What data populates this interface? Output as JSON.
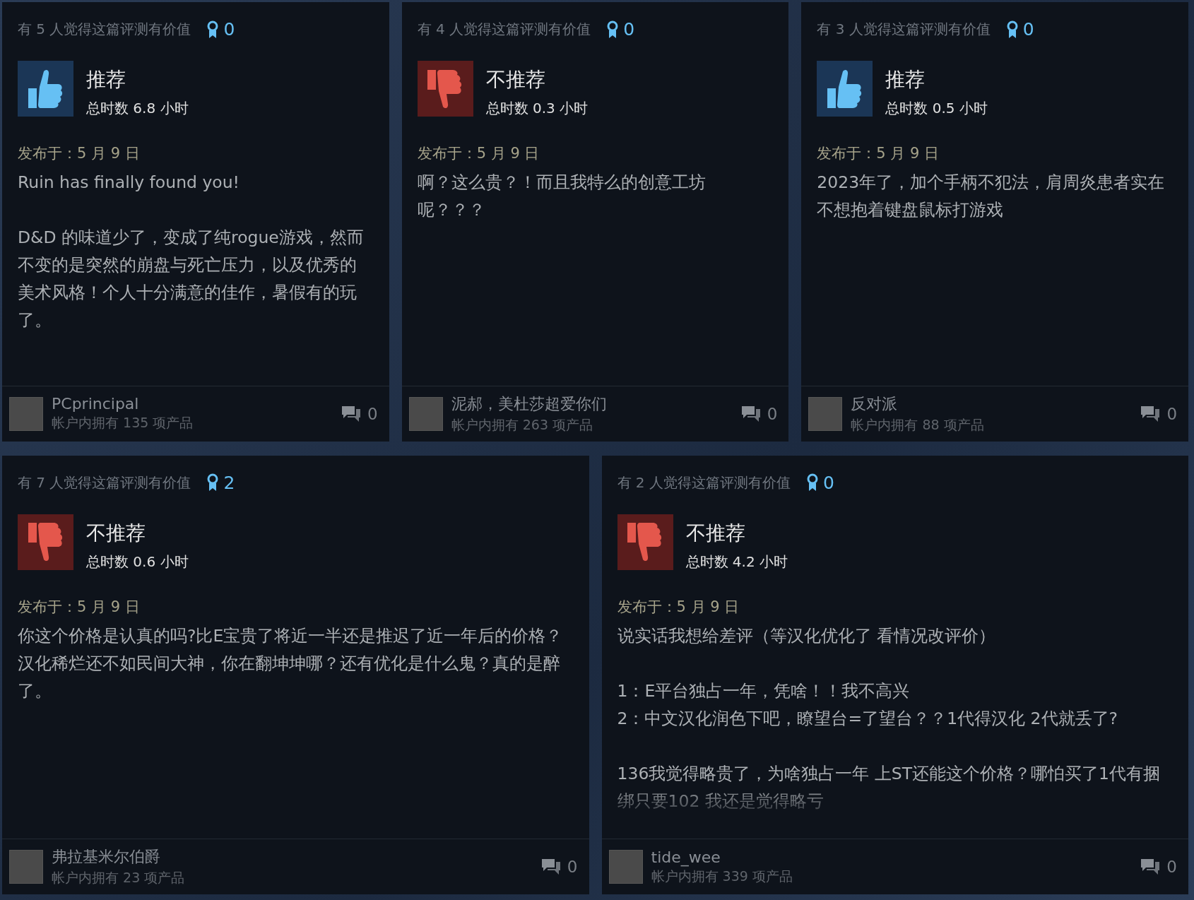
{
  "rows": [
    [
      {
        "helpful": "有 5 人觉得这篇评测有价值",
        "awards": "0",
        "recommended": true,
        "verdict": "推荐",
        "hours": "总时数 6.8 小时",
        "posted": "发布于：5 月 9 日",
        "paragraphs": [
          "Ruin has finally found you!",
          "D&D 的味道少了，变成了纯rogue游戏，然而不变的是突然的崩盘与死亡压力，以及优秀的美术风格！个人十分满意的佳作，暑假有的玩了。"
        ],
        "author": "PCprincipal",
        "products": "帐户内拥有 135 项产品",
        "comments": "0"
      },
      {
        "helpful": "有 4 人觉得这篇评测有价值",
        "awards": "0",
        "recommended": false,
        "verdict": "不推荐",
        "hours": "总时数 0.3 小时",
        "posted": "发布于：5 月 9 日",
        "paragraphs": [
          "啊？这么贵？！而且我特么的创意工坊呢？？？"
        ],
        "author": "泥郝，美杜莎超爱你们",
        "products": "帐户内拥有 263 项产品",
        "comments": "0"
      },
      {
        "helpful": "有 3 人觉得这篇评测有价值",
        "awards": "0",
        "recommended": true,
        "verdict": "推荐",
        "hours": "总时数 0.5 小时",
        "posted": "发布于：5 月 9 日",
        "paragraphs": [
          "2023年了，加个手柄不犯法，肩周炎患者实在不想抱着键盘鼠标打游戏"
        ],
        "author": "反对派",
        "products": "帐户内拥有 88 项产品",
        "comments": "0"
      }
    ],
    [
      {
        "helpful": "有 7 人觉得这篇评测有价值",
        "awards": "2",
        "recommended": false,
        "verdict": "不推荐",
        "hours": "总时数 0.6 小时",
        "posted": "发布于：5 月 9 日",
        "paragraphs": [
          "你这个价格是认真的吗?比E宝贵了将近一半还是推迟了近一年后的价格？汉化稀烂还不如民间大神，你在翻坤坤哪？还有优化是什么鬼？真的是醉了。"
        ],
        "author": "弗拉基米尔伯爵",
        "products": "帐户内拥有 23 项产品",
        "comments": "0"
      },
      {
        "helpful": "有 2 人觉得这篇评测有价值",
        "awards": "0",
        "recommended": false,
        "verdict": "不推荐",
        "hours": "总时数 4.2 小时",
        "posted": "发布于：5 月 9 日",
        "paragraphs": [
          "说实话我想给差评（等汉化优化了 看情况改评价）",
          "1：E平台独占一年，凭啥！！我不高兴\n2：中文汉化润色下吧，瞭望台=了望台？？1代得汉化 2代就丢了?",
          "136我觉得略贵了，为啥独占一年 上ST还能这个价格？哪怕买了1代有捆绑只要102 我还是觉得略亏"
        ],
        "author": "tide_wee",
        "products": "帐户内拥有 339 项产品",
        "comments": "0"
      }
    ]
  ]
}
